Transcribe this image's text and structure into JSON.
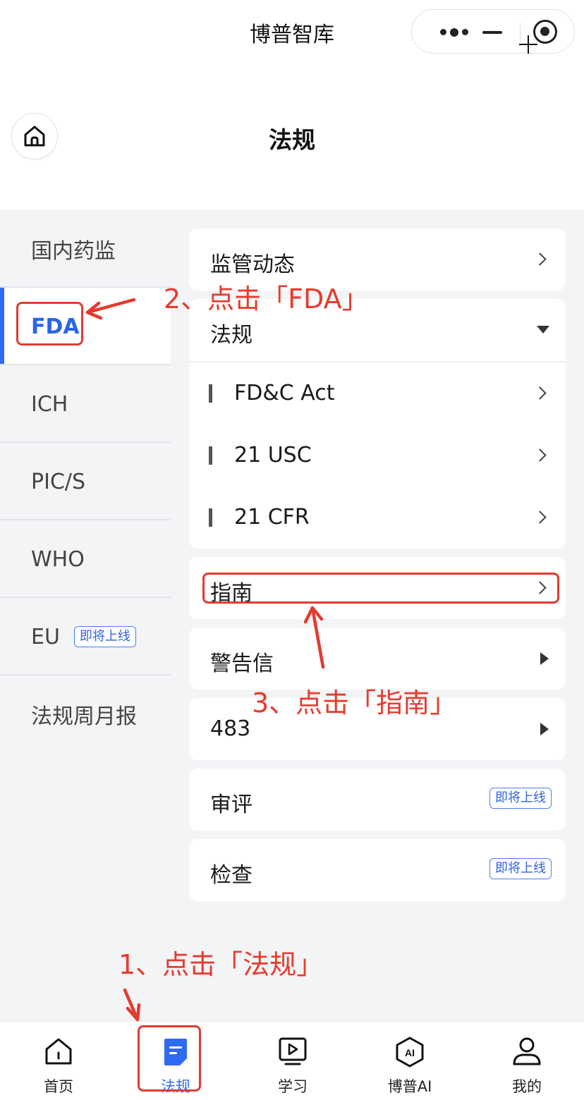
{
  "app": {
    "title": "博普智库"
  },
  "header": {
    "title": "法规"
  },
  "sidebar": {
    "items": [
      {
        "label": "国内药监"
      },
      {
        "label": "FDA",
        "active": true
      },
      {
        "label": "ICH"
      },
      {
        "label": "PIC/S"
      },
      {
        "label": "WHO"
      },
      {
        "label": "EU",
        "badge": "即将上线"
      },
      {
        "label": "法规周月报"
      }
    ]
  },
  "content": {
    "sections": [
      {
        "label": "监管动态",
        "icon": "chevron-right-icon"
      },
      {
        "label": "法规",
        "icon": "caret-down-icon",
        "expanded": true,
        "children": [
          {
            "label": "FD&C Act"
          },
          {
            "label": "21 USC"
          },
          {
            "label": "21 CFR"
          }
        ]
      },
      {
        "label": "指南",
        "icon": "chevron-right-icon"
      },
      {
        "label": "警告信",
        "icon": "caret-right-icon"
      },
      {
        "label": "483",
        "icon": "caret-right-icon"
      },
      {
        "label": "审评",
        "badge": "即将上线"
      },
      {
        "label": "检查",
        "badge": "即将上线"
      }
    ]
  },
  "tabbar": {
    "tabs": [
      {
        "label": "首页",
        "icon": "home-icon"
      },
      {
        "label": "法规",
        "icon": "regulation-doc-icon",
        "active": true
      },
      {
        "label": "学习",
        "icon": "play-icon"
      },
      {
        "label": "博普AI",
        "icon": "ai-hexagon-icon"
      },
      {
        "label": "我的",
        "icon": "user-icon"
      }
    ]
  },
  "annotations": {
    "step1": "1、点击「法规」",
    "step2": "2、点击「FDA」",
    "step3": "3、点击「指南」"
  },
  "colors": {
    "accent": "#2f6bf1",
    "annotation": "#e83a2c",
    "background": "#f3f4f6"
  }
}
